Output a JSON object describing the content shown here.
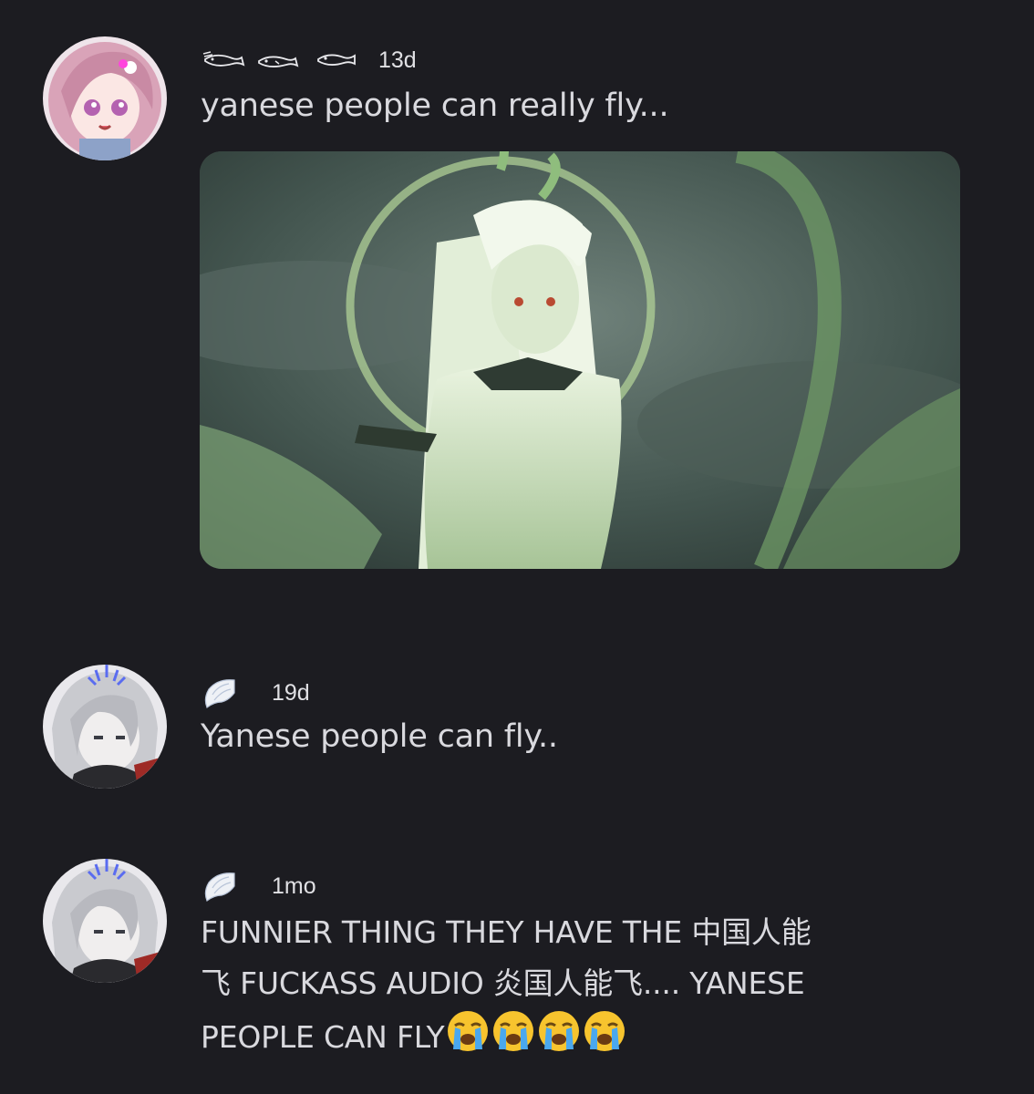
{
  "comments": [
    {
      "flair_icons": [
        "fish-icon",
        "fish-icon",
        "fish-icon"
      ],
      "time": "13d",
      "text": "yanese people can really fly...",
      "has_image": true
    },
    {
      "flair_icons": [
        "angel-wing-icon"
      ],
      "time": "19d",
      "text": "Yanese people can fly.."
    },
    {
      "flair_icons": [
        "angel-wing-icon"
      ],
      "time": "1mo",
      "text_lines": [
        "FUNNIER THING THEY HAVE THE 中国人能",
        "飞 FUCKASS AUDIO  炎国人能飞.... YANESE",
        "PEOPLE CAN FLY"
      ],
      "trailing_emoji": [
        "loudly-crying-face-emoji",
        "loudly-crying-face-emoji",
        "loudly-crying-face-emoji",
        "loudly-crying-face-emoji"
      ]
    }
  ],
  "colors": {
    "background": "#1c1c21",
    "text": "#d9d9de",
    "emoji_face": "#f7c42e",
    "emoji_tears": "#4aa8ee"
  }
}
